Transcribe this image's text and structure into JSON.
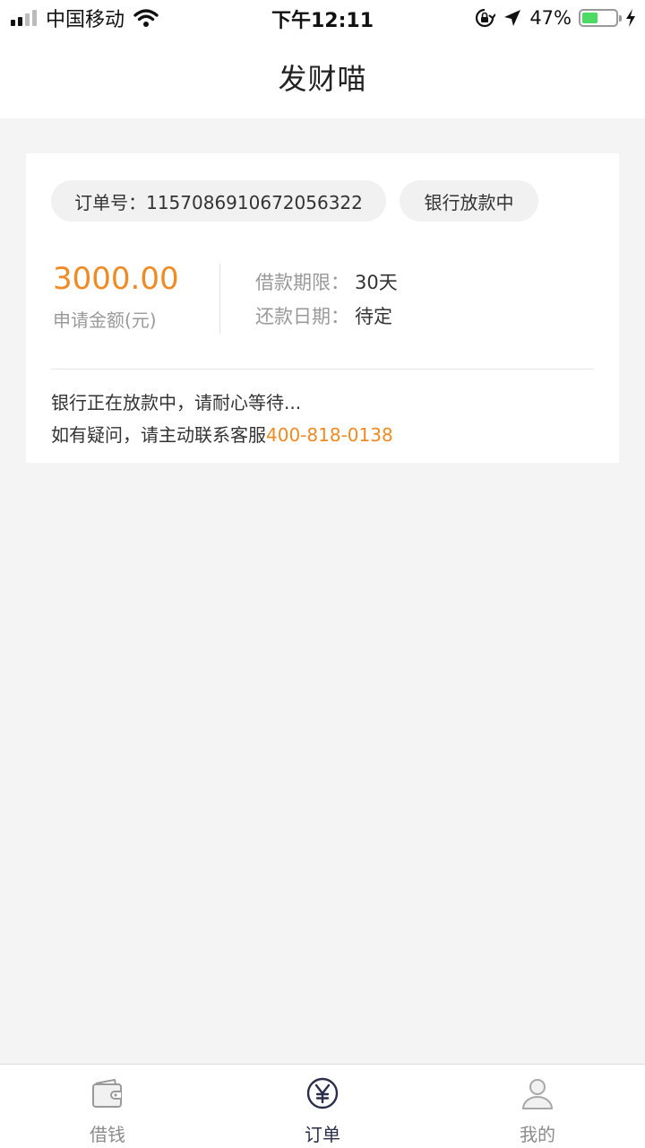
{
  "status_bar": {
    "carrier": "中国移动",
    "time": "下午12:11",
    "battery_percent": "47%",
    "battery_level": 0.47,
    "battery_color": "#4cd964",
    "icons": [
      "signal-icon",
      "wifi-icon",
      "rotation-lock-icon",
      "location-arrow-icon",
      "battery-icon",
      "charging-bolt-icon"
    ]
  },
  "nav": {
    "title": "发财喵"
  },
  "order": {
    "order_number_label": "订单号：1157086910672056322",
    "status": "银行放款中",
    "amount": "3000.00",
    "amount_label": "申请金额(元)",
    "term_label": "借款期限：",
    "term_value": "30天",
    "repay_date_label": "还款日期：",
    "repay_date_value": "待定",
    "message_line1": "银行正在放款中，请耐心等待...",
    "message_line2_prefix": "如有疑问，请主动联系客服",
    "service_phone": "400-818-0138"
  },
  "colors": {
    "accent": "#f08a24",
    "tab_active": "#2b2e4a",
    "tab_inactive": "#8c8c8c"
  },
  "tabs": [
    {
      "label": "借钱",
      "icon": "wallet-icon",
      "active": false
    },
    {
      "label": "订单",
      "icon": "yen-circle-icon",
      "active": true
    },
    {
      "label": "我的",
      "icon": "user-icon",
      "active": false
    }
  ]
}
